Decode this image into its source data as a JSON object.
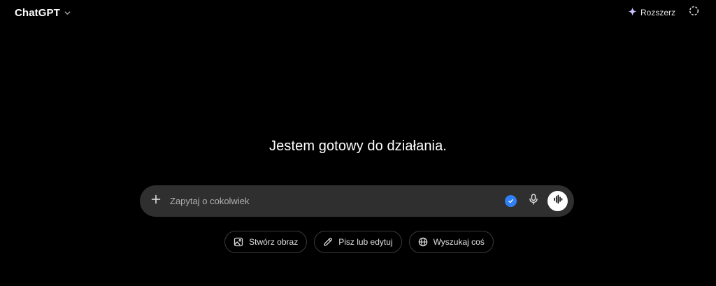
{
  "header": {
    "model_name": "ChatGPT",
    "upgrade_label": "Rozszerz"
  },
  "greeting": "Jestem gotowy do działania.",
  "composer": {
    "placeholder": "Zapytaj o cokolwiek"
  },
  "chips": [
    {
      "label": "Stwórz obraz",
      "icon": "image-icon"
    },
    {
      "label": "Pisz lub edytuj",
      "icon": "pencil-icon"
    },
    {
      "label": "Wyszukaj coś",
      "icon": "globe-icon"
    }
  ],
  "colors": {
    "background": "#000000",
    "composer_bg": "#2f2f2f",
    "accent_blue": "#2f7ff5",
    "upgrade_sparkle": "#c9c4ff"
  }
}
